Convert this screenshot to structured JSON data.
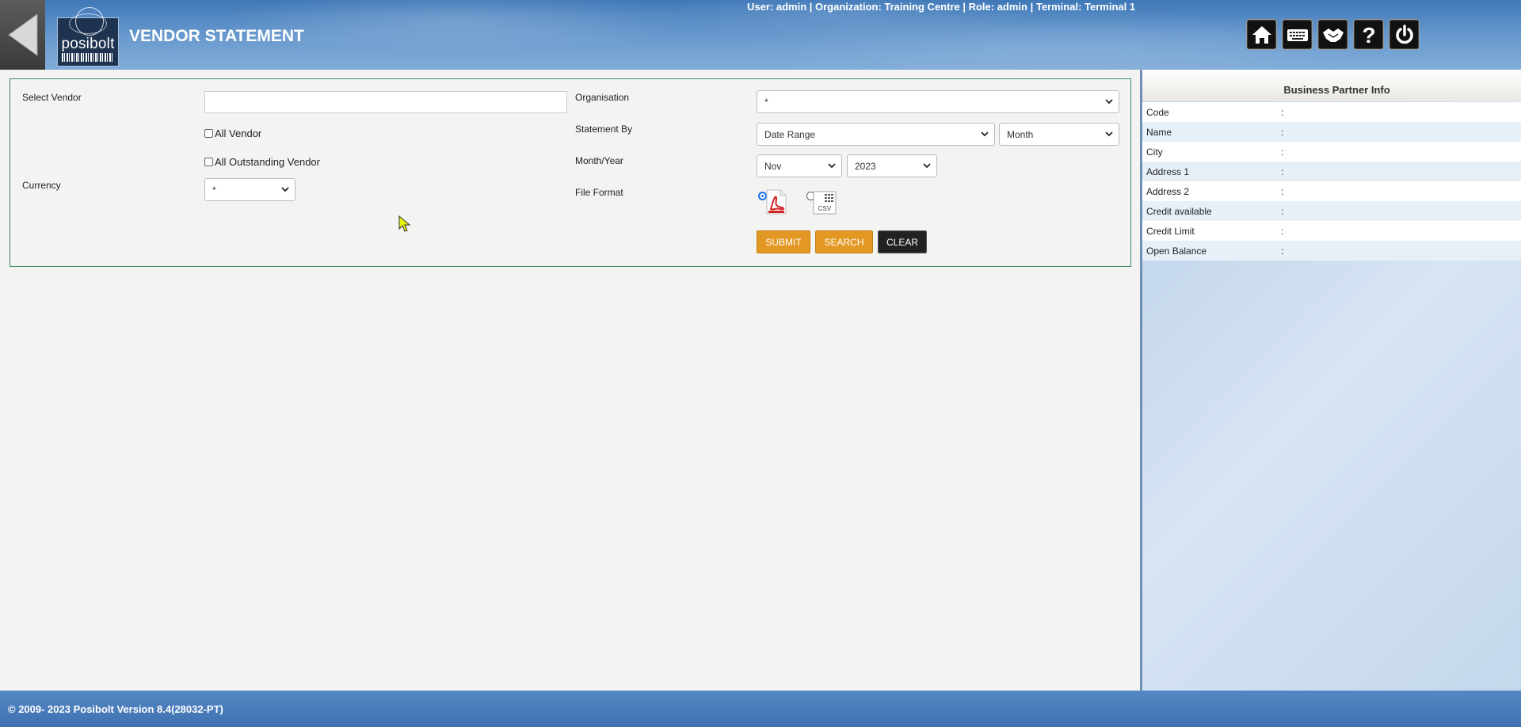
{
  "header": {
    "title": "VENDOR STATEMENT",
    "logo_text": "posibolt",
    "user_info": "User: admin | Organization: Training Centre | Role: admin | Terminal: Terminal 1",
    "tools": [
      {
        "name": "home-icon"
      },
      {
        "name": "keyboard-icon"
      },
      {
        "name": "handshake-icon"
      },
      {
        "name": "help-icon"
      },
      {
        "name": "power-icon"
      }
    ]
  },
  "form": {
    "select_vendor_label": "Select Vendor",
    "vendor_value": "",
    "all_vendor_label": "All Vendor",
    "all_outstanding_label": "All Outstanding Vendor",
    "currency_label": "Currency",
    "currency_value": "*",
    "organisation_label": "Organisation",
    "organisation_value": "*",
    "statement_by_label": "Statement By",
    "statement_by_value": "Date Range",
    "period_value": "Month",
    "month_year_label": "Month/Year",
    "month_value": "Nov",
    "year_value": "2023",
    "file_format_label": "File Format",
    "file_formats": [
      {
        "name": "pdf",
        "selected": true,
        "icon": "pdf-file-icon"
      },
      {
        "name": "csv",
        "selected": false,
        "icon": "csv-file-icon",
        "text": "CSV"
      }
    ],
    "buttons": {
      "submit": "SUBMIT",
      "search": "SEARCH",
      "clear": "CLEAR"
    }
  },
  "business_partner": {
    "title": "Business Partner Info",
    "rows": [
      {
        "label": "Code",
        "sep": ":"
      },
      {
        "label": "Name",
        "sep": ":"
      },
      {
        "label": "City",
        "sep": ":"
      },
      {
        "label": "Address 1",
        "sep": ":"
      },
      {
        "label": "Address 2",
        "sep": ":"
      },
      {
        "label": "Credit available",
        "sep": ":"
      },
      {
        "label": "Credit Limit",
        "sep": ":"
      },
      {
        "label": "Open Balance",
        "sep": ":"
      }
    ]
  },
  "footer": {
    "text": "© 2009- 2023 Posibolt Version  8.4(28032-PT)"
  },
  "colors": {
    "header_blue": "#4a80bf",
    "accent_orange": "#e39824",
    "panel_border": "#3c8a6a"
  }
}
